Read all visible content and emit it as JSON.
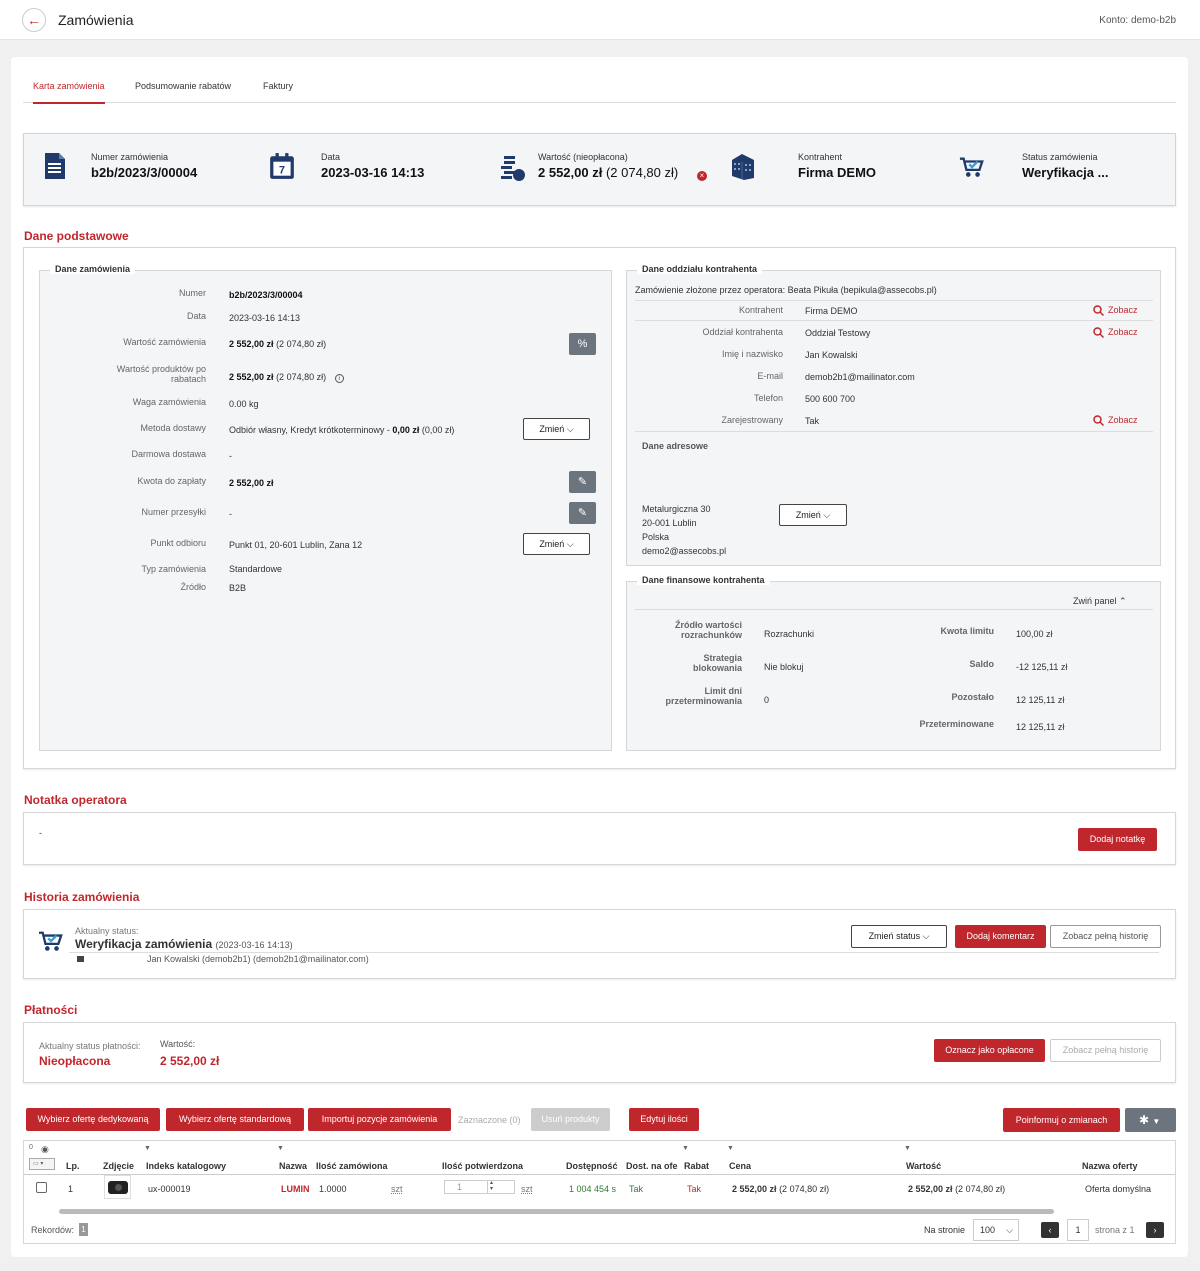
{
  "header": {
    "title": "Zamówienia",
    "account": "Konto: demo-b2b"
  },
  "tabs": [
    "Karta zamówienia",
    "Podsumowanie rabatów",
    "Faktury"
  ],
  "summary": {
    "number_label": "Numer zamówienia",
    "number": "b2b/2023/3/00004",
    "date_label": "Data",
    "date": "2023-03-16 14:13",
    "value_label": "Wartość (nieopłacona)",
    "value": "2 552,00 zł",
    "value_gross": "(2 074,80 zł)",
    "contractor_label": "Kontrahent",
    "contractor": "Firma DEMO",
    "status_label": "Status zamówienia",
    "status": "Weryfikacja ..."
  },
  "basic": {
    "title": "Dane podstawowe",
    "order": {
      "title": "Dane zamówienia",
      "numer_l": "Numer",
      "numer": "b2b/2023/3/00004",
      "data_l": "Data",
      "data": "2023-03-16 14:13",
      "wart_l": "Wartość zamówienia",
      "wart": "2 552,00 zł",
      "wart2": "(2 074,80 zł)",
      "wprod_l": "Wartość produktów po rabatach",
      "wprod": "2 552,00 zł",
      "wprod2": "(2 074,80 zł)",
      "waga_l": "Waga zamówienia",
      "waga": "0.00 kg",
      "metoda_l": "Metoda dostawy",
      "metoda": "Odbiór własny, Kredyt krótkoterminowy - ",
      "metoda_b": "0,00 zł",
      "metoda2": " (0,00 zł)",
      "darm_l": "Darmowa dostawa",
      "darm": "-",
      "kwota_l": "Kwota do zapłaty",
      "kwota": "2 552,00 zł",
      "nrp_l": "Numer przesyłki",
      "nrp": "-",
      "punkt_l": "Punkt odbioru",
      "punkt": "Punkt 01, 20-601 Lublin, Zana 12",
      "typ_l": "Typ zamówienia",
      "typ": "Standardowe",
      "zrodlo_l": "Źródło",
      "zrodlo": "B2B",
      "change": "Zmień"
    },
    "branch": {
      "title": "Dane oddziału kontrahenta",
      "operator": "Zamówienie złożone przez operatora: Beata Pikuła (bepikula@assecobs.pl)",
      "kontr_l": "Kontrahent",
      "kontr": "Firma DEMO",
      "oddz_l": "Oddział kontrahenta",
      "oddz": "Oddział Testowy",
      "imie_l": "Imię i nazwisko",
      "imie": "Jan Kowalski",
      "email_l": "E-mail",
      "email": "demob2b1@mailinator.com",
      "tel_l": "Telefon",
      "tel": "500 600 700",
      "zar_l": "Zarejestrowany",
      "zar": "Tak",
      "see": "Zobacz",
      "addr_title": "Dane adresowe",
      "addr": [
        "Metalurgiczna 30",
        "20-001 Lublin",
        "Polska",
        "demo2@assecobs.pl"
      ],
      "change": "Zmień"
    },
    "fin": {
      "title": "Dane finansowe kontrahenta",
      "collapse": "Zwiń panel",
      "zr_l": "Źródło wartości rozrachunków",
      "zr": "Rozrachunki",
      "st_l": "Strategia blokowania",
      "st": "Nie blokuj",
      "ld_l": "Limit dni przeterminowania",
      "ld": "0",
      "kl_l": "Kwota limitu",
      "kl": "100,00 zł",
      "sa_l": "Saldo",
      "sa": "-12 125,11 zł",
      "po_l": "Pozostało",
      "po": "12 125,11 zł",
      "pr_l": "Przeterminowane",
      "pr": "12 125,11 zł"
    }
  },
  "note": {
    "title": "Notatka operatora",
    "text": "-",
    "add": "Dodaj notatkę"
  },
  "history": {
    "title": "Historia zamówienia",
    "cur_label": "Aktualny status:",
    "status": "Weryfikacja zamówienia",
    "date": "(2023-03-16 14:13)",
    "user": "Jan Kowalski (demob2b1) (demob2b1@mailinator.com)",
    "change": "Zmień status",
    "comment": "Dodaj komentarz",
    "full": "Zobacz pełną historię"
  },
  "payments": {
    "title": "Płatności",
    "status_l": "Aktualny status płatności:",
    "status": "Nieopłacona",
    "value_l": "Wartość:",
    "value": "2 552,00 zł",
    "mark": "Oznacz jako opłacone",
    "full": "Zobacz pełną historię"
  },
  "toolbar": {
    "ded": "Wybierz ofertę dedykowaną",
    "std": "Wybierz ofertę standardową",
    "imp": "Importuj pozycje zamówienia",
    "sel": "Zaznaczone (0)",
    "del": "Usuń produkty",
    "edit": "Edytuj ilości",
    "inform": "Poinformuj o zmianach"
  },
  "table": {
    "headers": {
      "lp": "Lp.",
      "zdj": "Zdjęcie",
      "idx": "Indeks katalogowy",
      "naz": "Nazwa",
      "ilz": "Ilość zamówiona",
      "ilp": "Ilość potwierdzona",
      "dost": "Dostępność",
      "dof": "Dost. na ofe",
      "rab": "Rabat",
      "cena": "Cena",
      "wart": "Wartość",
      "noft": "Nazwa oferty"
    },
    "row": {
      "lp": "1",
      "idx": "ux-000019",
      "naz": "LUMIN",
      "ilz": "1.0000",
      "unit": "szt",
      "ilp": "1",
      "dost": "1 004 454 s",
      "dof": "Tak",
      "rab": "Tak",
      "cena": "2 552,00 zł",
      "cena2": "(2 074,80 zł)",
      "wart": "2 552,00 zł",
      "wart2": "(2 074,80 zł)",
      "noft": "Oferta domyślna"
    },
    "records_l": "Rekordów:",
    "records": "1",
    "per_page_l": "Na stronie",
    "per_page": "100",
    "page": "1",
    "page_of": "strona z 1",
    "count": "0"
  }
}
